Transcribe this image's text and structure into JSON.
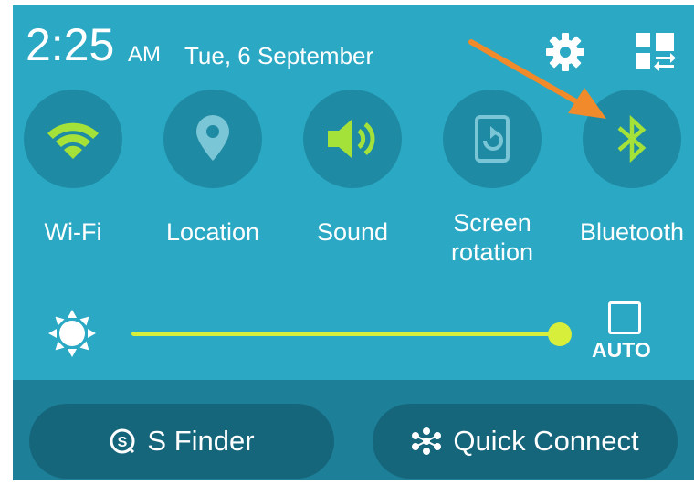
{
  "status": {
    "time": "2:25",
    "ampm": "AM",
    "date": "Tue, 6 September",
    "settings_icon": "gear-icon",
    "edit_icon": "grid-toggle-icon"
  },
  "toggles": [
    {
      "label": "Wi-Fi",
      "icon": "wifi-icon",
      "active": true
    },
    {
      "label": "Location",
      "icon": "location-pin-icon",
      "active": false
    },
    {
      "label": "Sound",
      "icon": "speaker-icon",
      "active": true
    },
    {
      "label": "Screen rotation",
      "label_line1": "Screen",
      "label_line2": "rotation",
      "icon": "screen-rotation-icon",
      "active": false
    },
    {
      "label": "Bluetooth",
      "icon": "bluetooth-icon",
      "active": true
    }
  ],
  "brightness": {
    "level": 1.0,
    "auto_label": "AUTO",
    "auto_checked": false
  },
  "buttons": {
    "sfinder": "S Finder",
    "quick_connect": "Quick Connect"
  },
  "colors": {
    "panel": "#2aa8c4",
    "toggle_bg": "#1f8aa3",
    "active_green": "#a4e23a",
    "inactive": "#7ac6d6",
    "slider": "#d7ee3a",
    "annotation_arrow": "#f08a2a"
  }
}
